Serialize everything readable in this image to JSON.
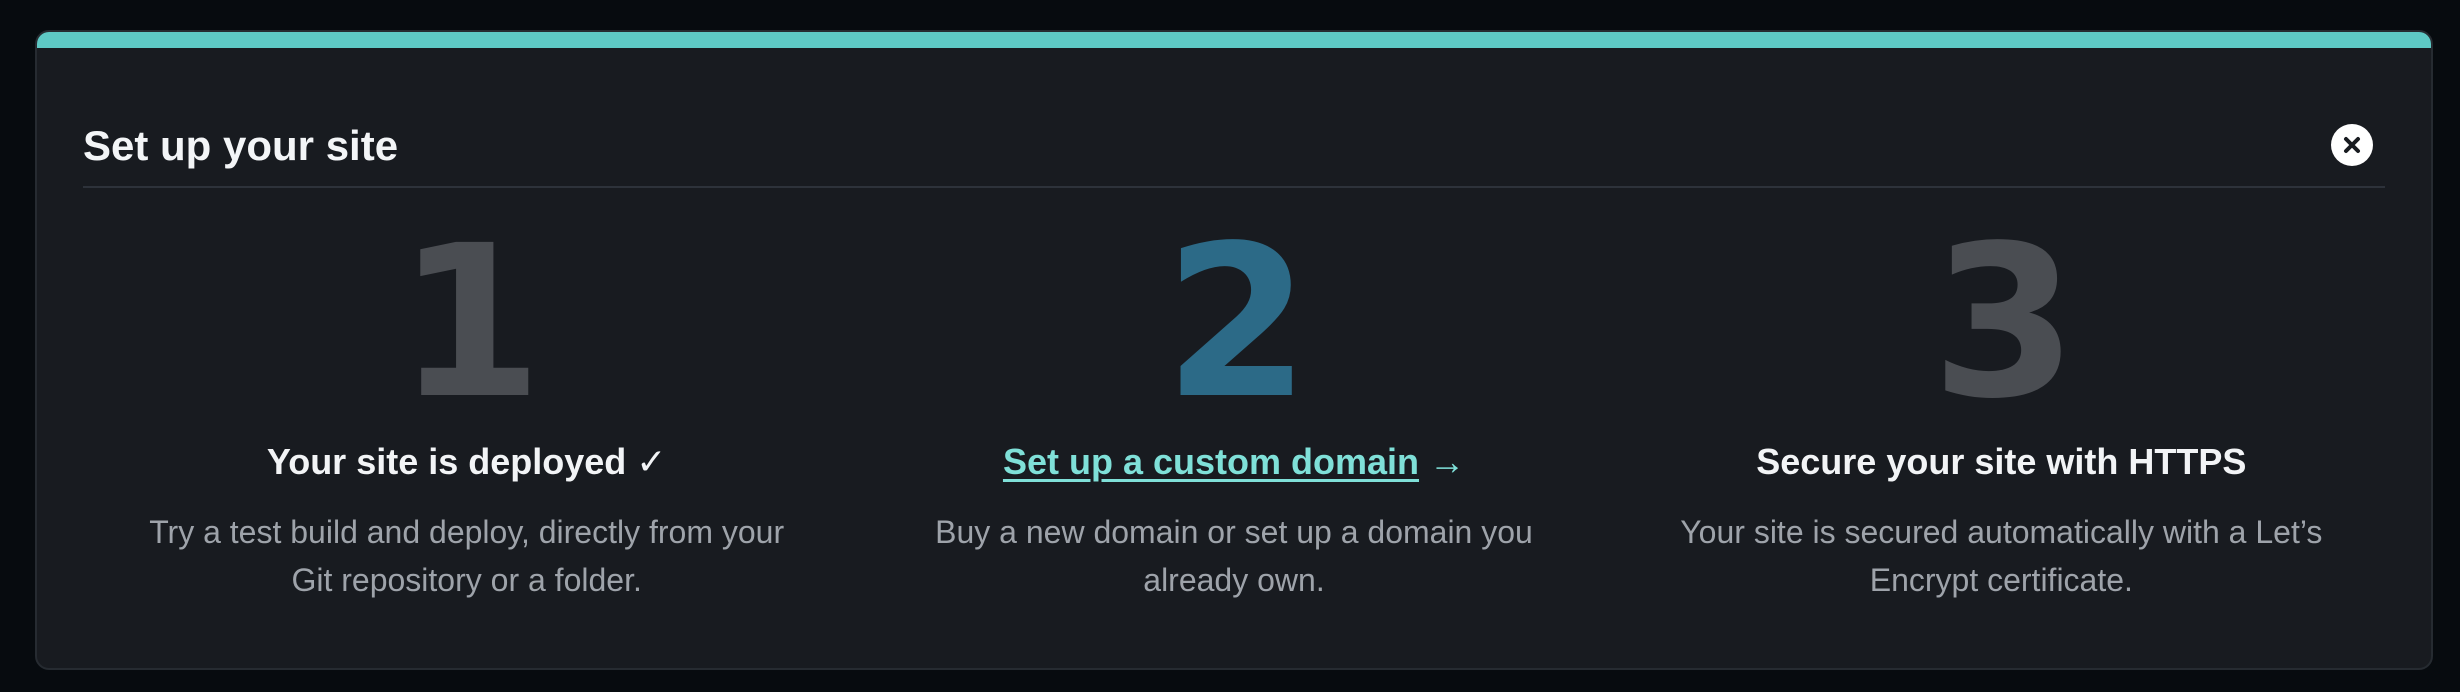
{
  "panel": {
    "title": "Set up your site",
    "close_icon": "close-icon",
    "accent_color": "#5ec9c5"
  },
  "steps": [
    {
      "number": "1",
      "heading": "Your site is deployed",
      "status_mark": "✓",
      "desc_line1": "Try a test build and deploy, directly from your",
      "desc_line2": "Git repository or a folder."
    },
    {
      "number": "2",
      "heading": "Set up a custom domain",
      "arrow": "→",
      "desc_line1": "Buy a new domain or set up a domain you",
      "desc_line2": "already own.",
      "link_color": "#7fe0d8"
    },
    {
      "number": "3",
      "heading": "Secure your site with HTTPS",
      "desc_line1": "Your site is secured automatically with a Let’s",
      "desc_line2": "Encrypt certificate."
    }
  ]
}
